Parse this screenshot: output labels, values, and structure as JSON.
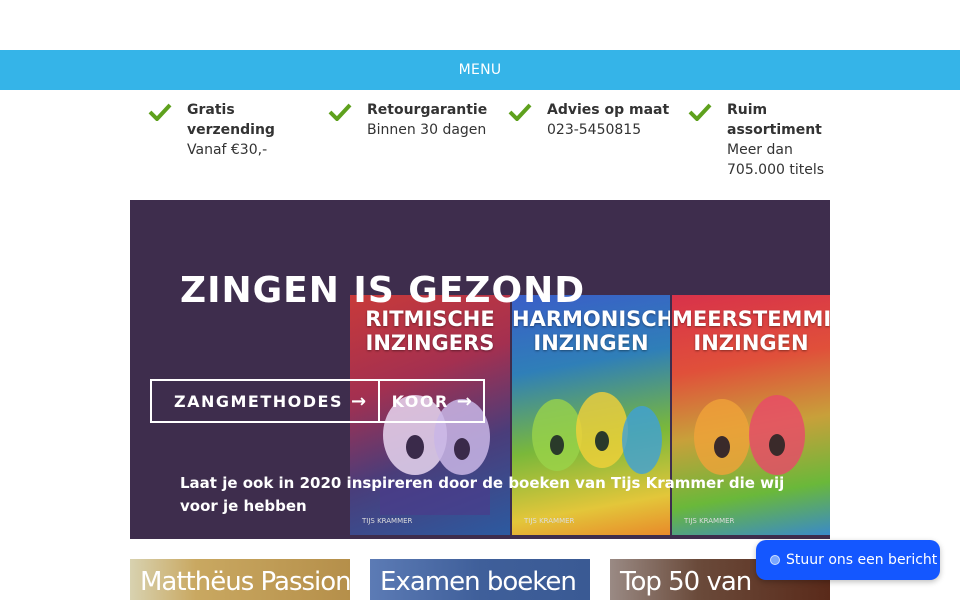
{
  "menu": {
    "label": "MENU"
  },
  "usps": [
    {
      "title": "Gratis verzending",
      "subtitle": "Vanaf €30,-"
    },
    {
      "title": "Retourgarantie",
      "subtitle": "Binnen 30 dagen"
    },
    {
      "title": "Advies op maat",
      "subtitle": "023-5450815"
    },
    {
      "title": "Ruim assortiment",
      "subtitle": "Meer dan 705.000 titels"
    }
  ],
  "hero": {
    "title": "ZINGEN IS GEZOND",
    "buttons": [
      {
        "label": "ZANGMETHODES",
        "arrow": "→"
      },
      {
        "label": "KOOR",
        "arrow": "→"
      }
    ],
    "description": "Laat je ook in 2020 inspireren door de boeken van Tijs Krammer die wij voor je hebben",
    "covers": [
      {
        "title_line1": "RITMISCHE",
        "title_line2": "INZINGERS",
        "author": "TIJS KRAMMER"
      },
      {
        "title_line1": "HARMONISCH",
        "title_line2": "INZINGEN",
        "author": "TIJS KRAMMER"
      },
      {
        "title_line1": "MEERSTEMMIG",
        "title_line2": "INZINGEN",
        "author": "TIJS KRAMMER"
      }
    ]
  },
  "tiles": [
    {
      "label": "Matthëus Passion"
    },
    {
      "label": "Examen boeken"
    },
    {
      "label": "Top 50 van"
    }
  ],
  "chat": {
    "label": "Stuur ons een bericht"
  },
  "colors": {
    "menu_bar": "#35b4e8",
    "check": "#5ea11d",
    "hero_bg": "#3e2d4d",
    "chat_button": "#1457ff"
  }
}
